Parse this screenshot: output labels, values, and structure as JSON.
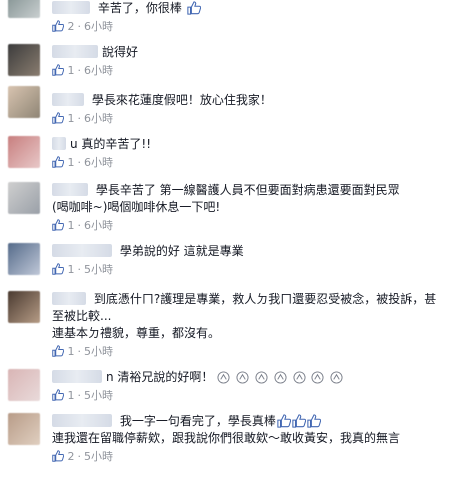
{
  "comments": [
    {
      "text": "辛苦了，你很棒",
      "trailing_icons": [
        "thumbs-up-icon"
      ],
      "likes": "2",
      "time": "6小時",
      "avatar": "a0"
    },
    {
      "text": "說得好",
      "trailing_icons": [],
      "likes": "1",
      "time": "6小時",
      "avatar": "a1"
    },
    {
      "text": "學長來花蓮度假吧！放心住我家！",
      "trailing_icons": [],
      "likes": "1",
      "time": "6小時",
      "avatar": "a2"
    },
    {
      "text": "u 真的辛苦了!!",
      "trailing_icons": [],
      "likes": "1",
      "time": "6小時",
      "avatar": "a3"
    },
    {
      "text": "學長辛苦了 第一線醫護人員不但要面對病患還要面對民眾",
      "text2": "(喝咖啡~)喝個咖啡休息一下吧!",
      "trailing_icons": [],
      "likes": "1",
      "time": "6小時",
      "avatar": "a4"
    },
    {
      "text": "學弟說的好 這就是專業",
      "trailing_icons": [],
      "likes": "1",
      "time": "5小時",
      "avatar": "a5"
    },
    {
      "text": "到底憑什ㄇ?護理是專業，救人ㄉ我ㄇ還要忍受被念，被投訴，甚",
      "text2": "至被比較...",
      "text3": "連基本ㄉ禮貌，尊重，都沒有。",
      "trailing_icons": [],
      "likes": "1",
      "time": "5小時",
      "avatar": "a6"
    },
    {
      "text": "n 清裕兄說的好啊！",
      "trailing_icons": [
        "clap-icon",
        "clap-icon",
        "clap-icon",
        "clap-icon",
        "clap-icon",
        "clap-icon",
        "clap-icon"
      ],
      "likes": "1",
      "time": "5小時",
      "avatar": "a7"
    },
    {
      "text": "我一字一句看完了，學長真棒",
      "trailing_icons": [
        "thumbs-up-icon",
        "thumbs-up-icon",
        "thumbs-up-icon"
      ],
      "text2": "連我還在留職停薪欸，跟我說你們很敢欸～敢收黃安，我真的無言",
      "likes": "2",
      "time": "5小時",
      "avatar": "a8"
    }
  ],
  "colors": {
    "link": "#365899",
    "meta": "#90949c",
    "text": "#141823",
    "like_blue": "#4267b2"
  }
}
